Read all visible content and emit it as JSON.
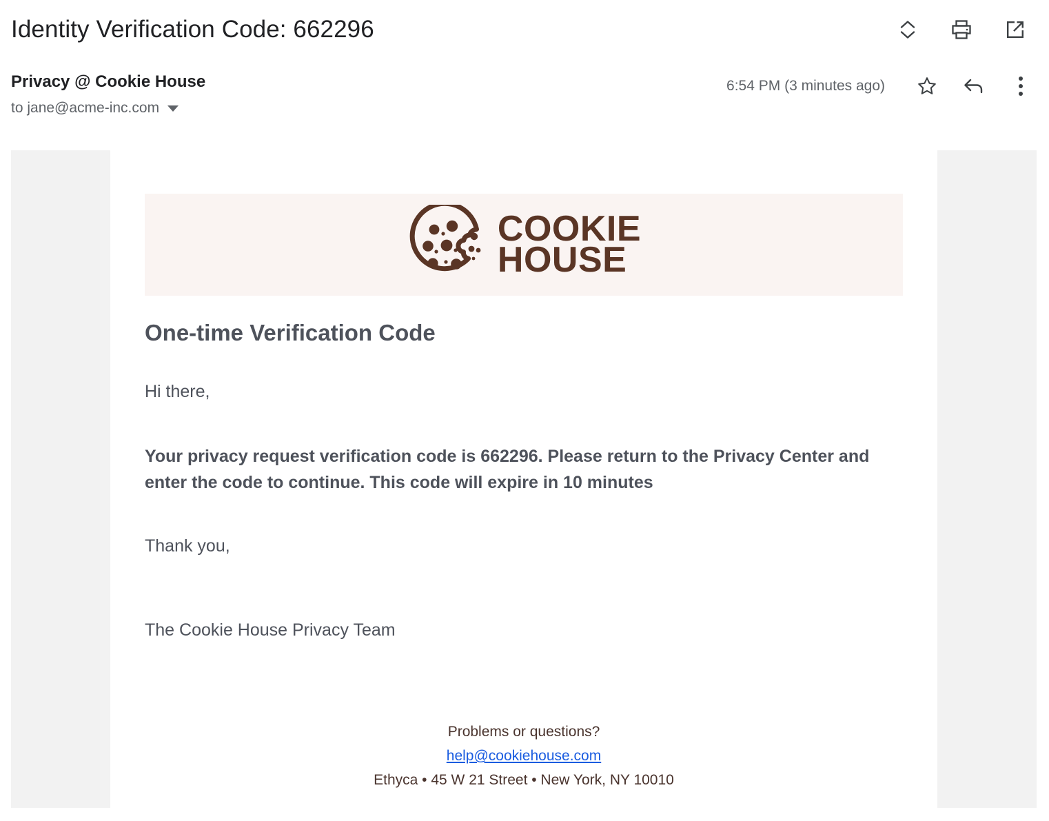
{
  "window": {
    "subject": "Identity Verification Code: 662296",
    "actions": [
      {
        "name": "expand-collapse",
        "label": "Expand or collapse"
      },
      {
        "name": "print",
        "label": "Print"
      },
      {
        "name": "open-in-new-window",
        "label": "Open in new window"
      }
    ]
  },
  "message": {
    "sender": "Privacy @ Cookie House",
    "recipient": "to jane@acme-inc.com",
    "timestamp": "6:54 PM (3 minutes ago)",
    "actions": [
      {
        "name": "star",
        "label": "Star"
      },
      {
        "name": "reply",
        "label": "Reply"
      },
      {
        "name": "more",
        "label": "More"
      }
    ]
  },
  "email": {
    "brand": {
      "line1": "COOKIE",
      "line2": "HOUSE",
      "logo_color": "#5a3525",
      "banner_background": "#faf4f2"
    },
    "heading": "One-time Verification Code",
    "greeting": "Hi there,",
    "main_paragraph": "Your privacy request verification code is 662296. Please return to the Privacy Center and enter the code to continue. This code will expire in 10 minutes",
    "signoff": "Thank you,",
    "team": "The Cookie House Privacy Team",
    "verification_code": "662296",
    "footer": {
      "question": "Problems or questions?",
      "support_email": "help@cookiehouse.com",
      "address": "Ethyca • 45 W 21 Street • New York, NY 10010"
    }
  }
}
